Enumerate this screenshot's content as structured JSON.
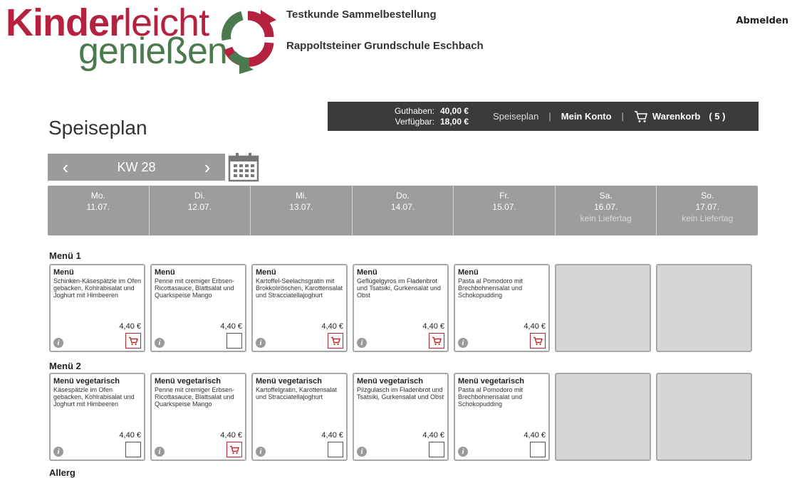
{
  "logo": {
    "part1_bold": "Kinder",
    "part1_light": "leicht",
    "part2": "genießen"
  },
  "customer": {
    "line1": "Testkunde Sammelbestellung",
    "line2": "Rappoltsteiner Grundschule Eschbach"
  },
  "logout_label": "Abmelden",
  "account": {
    "guthaben_label": "Guthaben:",
    "guthaben_value": "40,00 €",
    "verfuegbar_label": "Verfügbar:",
    "verfuegbar_value": "18,00 €",
    "nav_speiseplan": "Speiseplan",
    "nav_konto": "Mein Konto",
    "cart_label": "Warenkorb",
    "cart_count": "( 5 )",
    "sep": "|"
  },
  "page_title": "Speiseplan",
  "week": {
    "label": "KW 28",
    "prev": "‹",
    "next": "›"
  },
  "days": [
    {
      "name": "Mo.",
      "date": "11.07.",
      "note": ""
    },
    {
      "name": "Di.",
      "date": "12.07.",
      "note": ""
    },
    {
      "name": "Mi.",
      "date": "13.07.",
      "note": ""
    },
    {
      "name": "Do.",
      "date": "14.07.",
      "note": ""
    },
    {
      "name": "Fr.",
      "date": "15.07.",
      "note": ""
    },
    {
      "name": "Sa.",
      "date": "16.07.",
      "note": "kein Liefertag"
    },
    {
      "name": "So.",
      "date": "17.07.",
      "note": "kein Liefertag"
    }
  ],
  "menus": [
    {
      "label": "Menü 1",
      "items": [
        {
          "title": "Menü",
          "desc": "Schinken-Käsespätzle im Ofen gebacken, Kohlrabisalat und Joghurt mit Himbeeren",
          "price": "4,40 €",
          "ordered": true
        },
        {
          "title": "Menü",
          "desc": "Penne mit cremiger Erbsen-Ricottasauce, Blattsalat und Quarkspeise Mango",
          "price": "4,40 €",
          "ordered": false
        },
        {
          "title": "Menü",
          "desc": "Kartoffel-Seelachsgratin mit Brokkoliröschen, Karottensalat und Stracciatellajoghurt",
          "price": "4,40 €",
          "ordered": true
        },
        {
          "title": "Menü",
          "desc": "Geflügelgyros im Fladenbrot und Tsatsiki, Gurkensalat und Obst",
          "price": "4,40 €",
          "ordered": true
        },
        {
          "title": "Menü",
          "desc": "Pasta al Pomodoro mit Brechbohnensalat und Schokopudding",
          "price": "4,40 €",
          "ordered": true
        }
      ]
    },
    {
      "label": "Menü 2",
      "items": [
        {
          "title": "Menü vegetarisch",
          "desc": "Käsespätzle im Ofen gebacken, Kohlrabisalat und Joghurt mit Himbeeren",
          "price": "4,40 €",
          "ordered": false
        },
        {
          "title": "Menü vegetarisch",
          "desc": "Penne mit cremiger Erbsen-Ricottasauce, Blattsalat und Quarkspeise Mango",
          "price": "4,40 €",
          "ordered": true
        },
        {
          "title": "Menü vegetarisch",
          "desc": "Kartoffelgratin, Karottensalat und Stracciatellajoghurt",
          "price": "4,40 €",
          "ordered": false
        },
        {
          "title": "Menü vegetarisch",
          "desc": "Pilzgulasch im Fladenbrot und Tsatsiki, Gurkensalat und Obst",
          "price": "4,40 €",
          "ordered": false
        },
        {
          "title": "Menü vegetarisch",
          "desc": "Pasta al Pomodoro mit Brechbohnensalat und Schokopudding",
          "price": "4,40 €",
          "ordered": false
        }
      ]
    }
  ],
  "next_label_partial": "Allerg",
  "colors": {
    "brand_red": "#b5223f",
    "brand_green": "#4c7a4f",
    "bar_dark": "#3b3b3b",
    "day_gray": "#9d9d9d",
    "cart_red": "#c1272d"
  }
}
